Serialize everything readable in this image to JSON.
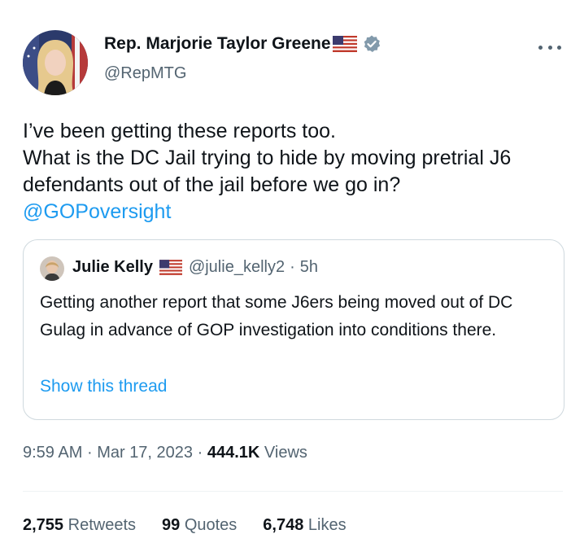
{
  "author": {
    "name": "Rep. Marjorie Taylor Greene",
    "handle": "@RepMTG",
    "flag_icon": "us-flag-icon",
    "verified_icon": "verified-badge-icon"
  },
  "tweet": {
    "text": "I’ve been getting these reports too.\nWhat is the DC Jail trying to hide by moving pretrial J6 defendants out of the jail before we go in?",
    "mention": "@GOPoversight"
  },
  "quote": {
    "name": "Julie Kelly",
    "handle": "@julie_kelly2",
    "dot": "·",
    "time": "5h",
    "text": "Getting another report that some J6ers being moved out of DC Gulag in advance of GOP investigation into conditions there.",
    "show_thread": "Show this thread"
  },
  "meta": {
    "time": "9:59 AM",
    "sep": "·",
    "date": "Mar 17, 2023",
    "views_count": "444.1K",
    "views_label": "Views"
  },
  "stats": {
    "retweets_count": "2,755",
    "retweets_label": "Retweets",
    "quotes_count": "99",
    "quotes_label": "Quotes",
    "likes_count": "6,748",
    "likes_label": "Likes"
  },
  "colors": {
    "link": "#1d9bf0",
    "secondary": "#536471",
    "verified": "#829aab"
  }
}
